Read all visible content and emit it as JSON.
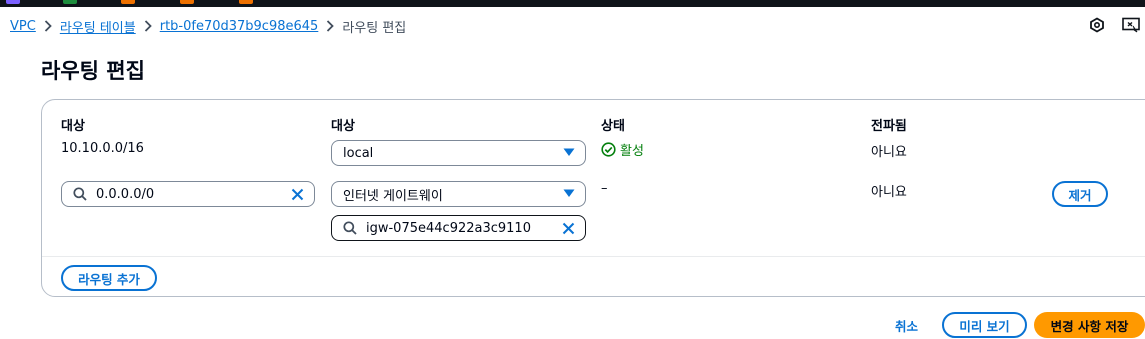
{
  "breadcrumb": {
    "items": [
      "VPC",
      "라우팅 테이블",
      "rtb-0fe70d37b9c98e645"
    ],
    "current": "라우팅 편집"
  },
  "header_icons": [
    "notifications-icon",
    "feedback-icon"
  ],
  "page_title": "라우팅 편집",
  "table": {
    "headers": {
      "destination": "대상",
      "target": "대상",
      "status": "상태",
      "propagated": "전파됨"
    },
    "rows": [
      {
        "destination": "10.10.0.0/16",
        "target_select": "local",
        "status": "활성",
        "propagated": "아니요"
      },
      {
        "destination_input": "0.0.0.0/0",
        "target_select": "인터넷 게이트웨이",
        "target_search": "igw-075e44c922a3c9110",
        "status": "–",
        "propagated": "아니요",
        "remove_label": "제거"
      }
    ],
    "add_route_label": "라우팅 추가"
  },
  "footer": {
    "cancel_label": "취소",
    "preview_label": "미리 보기",
    "save_label": "변경 사항 저장"
  },
  "colors": {
    "link": "#0972d3",
    "primary_button": "#ff9900",
    "success": "#037f0c",
    "top_bar": "#0f141a"
  }
}
